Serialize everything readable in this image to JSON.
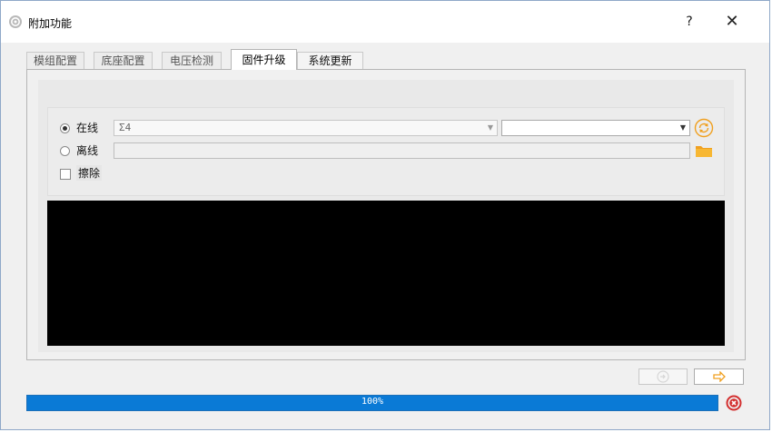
{
  "window": {
    "title": "附加功能",
    "help_label": "?",
    "close_label": "✕",
    "title_icon": "gear-icon"
  },
  "tabs": [
    {
      "label": "模组配置",
      "active": false
    },
    {
      "label": "底座配置",
      "active": false
    },
    {
      "label": "电压检测",
      "active": false
    },
    {
      "label": "固件升级",
      "active": true
    },
    {
      "label": "系统更新",
      "active": false
    }
  ],
  "firmware": {
    "online_label": "在线",
    "offline_label": "离线",
    "erase_label": "擦除",
    "online_selected": true,
    "erase_checked": false,
    "version_select_value": "Σ4",
    "device_select_value": "",
    "offline_path_value": "",
    "refresh_icon": "refresh-icon",
    "folder_icon": "folder-icon"
  },
  "console": {
    "text": ""
  },
  "footer": {
    "disabled_button_icon": "circle-arrow-icon",
    "next_button_icon": "arrow-right-icon"
  },
  "progress": {
    "value": 1.0,
    "text": "100%",
    "cancel_icon": "cancel-icon"
  },
  "colors": {
    "progress": "#0a7ad6",
    "accent_orange": "#f0a020",
    "cancel_red": "#d32f2f"
  }
}
